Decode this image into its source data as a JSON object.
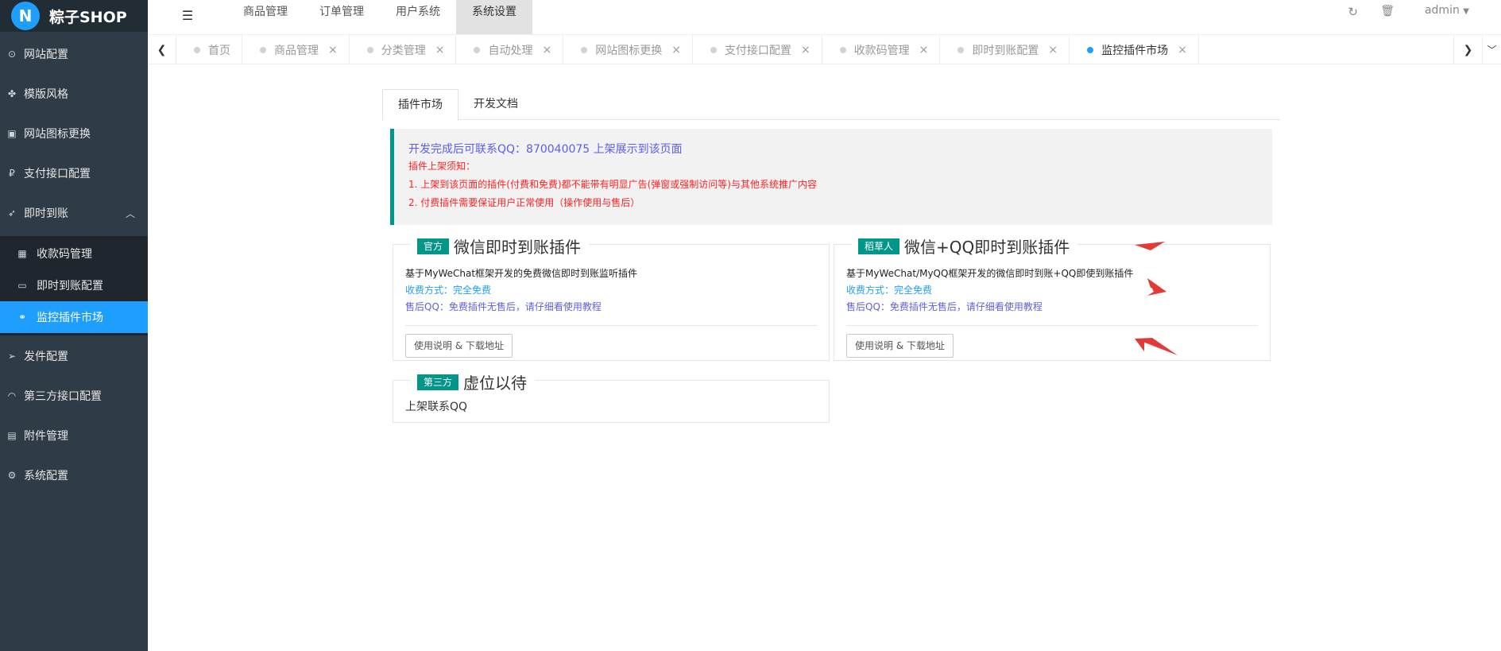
{
  "brand": {
    "logo_letter": "N",
    "name": "粽子SHOP"
  },
  "sidebar": {
    "items": [
      {
        "label": "网站配置",
        "icon": "target-icon"
      },
      {
        "label": "模版风格",
        "icon": "puzzle-icon"
      },
      {
        "label": "网站图标更换",
        "icon": "image-icon"
      },
      {
        "label": "支付接口配置",
        "icon": "payment-icon"
      },
      {
        "label": "即时到账",
        "icon": "rocket-icon"
      },
      {
        "label": "发件配置",
        "icon": "send-icon"
      },
      {
        "label": "第三方接口配置",
        "icon": "wifi-icon"
      },
      {
        "label": "附件管理",
        "icon": "file-icon"
      },
      {
        "label": "系统配置",
        "icon": "gear-icon"
      }
    ],
    "subitems": [
      {
        "label": "收款码管理",
        "icon": "qrcode-icon"
      },
      {
        "label": "即时到账配置",
        "icon": "laptop-icon"
      },
      {
        "label": "监控插件市场",
        "icon": "link-icon"
      }
    ]
  },
  "topnav": {
    "items": [
      "商品管理",
      "订单管理",
      "用户系统",
      "系统设置"
    ],
    "active_index": 3
  },
  "topright": {
    "user": "admin"
  },
  "tabs": {
    "items": [
      "首页",
      "商品管理",
      "分类管理",
      "自动处理",
      "网站图标更换",
      "支付接口配置",
      "收款码管理",
      "即时到账配置",
      "监控插件市场"
    ],
    "active_index": 8
  },
  "content_tabs": {
    "items": [
      "插件市场",
      "开发文档"
    ],
    "active_index": 0
  },
  "notice": {
    "line1": "开发完成后可联系QQ：870040075 上架展示到该页面",
    "line2": "插件上架须知：",
    "line3": "1. 上架到该页面的插件(付费和免费)都不能带有明显广告(弹窗或强制访问等)与其他系统推广内容",
    "line4": "2. 付费插件需要保证用户正常使用（操作使用与售后）"
  },
  "cards": [
    {
      "badge": "官方",
      "title": "微信即时到账插件",
      "desc": "基于MyWeChat框架开发的免费微信即时到账监听插件",
      "fee": "收费方式：完全免费",
      "support": "售后QQ：免费插件无售后，请仔细看使用教程",
      "button": "使用说明 & 下载地址"
    },
    {
      "badge": "稻草人",
      "title": "微信+QQ即时到账插件",
      "desc": "基于MyWeChat/MyQQ框架开发的微信即时到账+QQ即使到账插件",
      "fee": "收费方式：完全免费",
      "support": "售后QQ：免费插件无售后，请仔细看使用教程",
      "button": "使用说明 & 下载地址"
    },
    {
      "badge": "第三方",
      "title": "虚位以待",
      "body": "上架联系QQ"
    }
  ],
  "colors": {
    "sidebar_bg": "#2f3b47",
    "accent": "#1e9fff",
    "badge": "#009688",
    "annotation_red": "#e53935"
  }
}
